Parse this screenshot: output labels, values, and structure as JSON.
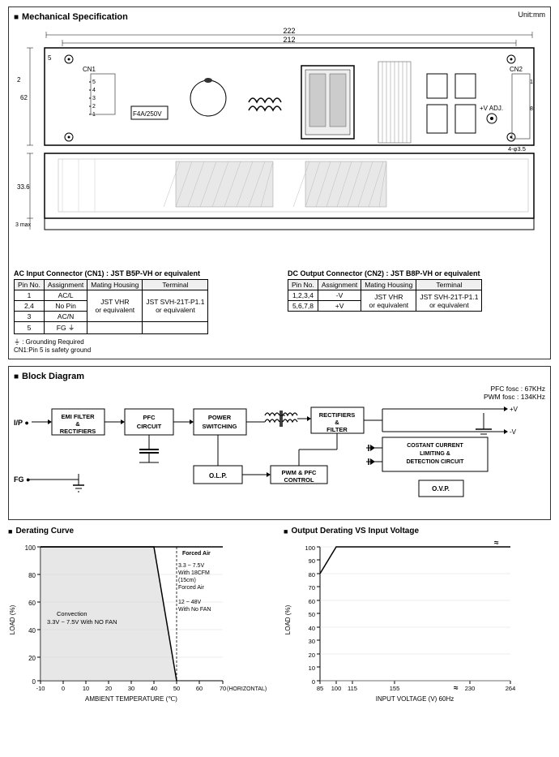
{
  "page": {
    "unit": "Unit:mm"
  },
  "mechanical": {
    "title": "Mechanical Specification",
    "unit": "Unit:mm",
    "dimensions": {
      "top": "222",
      "middle": "212",
      "left_height": "62",
      "left_small": "2",
      "bottom_height": "33.6",
      "bottom_small": "3 max",
      "left_width": "5",
      "hole": "4-φ3.5"
    },
    "labels": {
      "cn1": "CN1",
      "cn2": "CN2",
      "fuse": "F4A/250V",
      "vadj": "+V ADJ.",
      "pin5": "5",
      "pin4": "4",
      "pin3": "3",
      "pin2": "2",
      "pin1": "1"
    }
  },
  "connector_cn1": {
    "title": "AC Input Connector (CN1) : JST B5P-VH or equivalent",
    "headers": [
      "Pin No.",
      "Assignment",
      "Mating Housing",
      "Terminal"
    ],
    "rows": [
      [
        "1",
        "AC/L",
        "",
        ""
      ],
      [
        "2,4",
        "No Pin",
        "JST VHR",
        "JST SVH-21T-P1.1"
      ],
      [
        "3",
        "AC/N",
        "or equivalent",
        "or equivalent"
      ],
      [
        "5",
        "FG ⏚",
        "",
        ""
      ]
    ]
  },
  "connector_cn2": {
    "title": "DC Output Connector (CN2) : JST B8P-VH or equivalent",
    "headers": [
      "Pin No.",
      "Assignment",
      "Mating Housing",
      "Terminal"
    ],
    "rows": [
      [
        "1,2,3,4",
        "-V",
        "JST VHR",
        "JST SVH-21T-P1.1"
      ],
      [
        "5,6,7,8",
        "+V",
        "or equivalent",
        "or equivalent"
      ]
    ]
  },
  "grounding": {
    "line1": "⏚ : Grounding Required",
    "line2": "CN1:Pin 5 is safety ground"
  },
  "block_diagram": {
    "title": "Block Diagram",
    "fosc1": "PFC fosc : 67KHz",
    "fosc2": "PWM fosc : 134KHz",
    "blocks": [
      {
        "id": "emi",
        "label": "EMI FILTER\n& \nRECTIFIERS"
      },
      {
        "id": "pfc",
        "label": "PFC\nCIRCUIT"
      },
      {
        "id": "power",
        "label": "POWER\nSWITCHING"
      },
      {
        "id": "rect",
        "label": "RECTIFIERS\n&\nFILTER"
      },
      {
        "id": "olp",
        "label": "O.L.P."
      },
      {
        "id": "pwm",
        "label": "PWM & PFC\nCONTROL"
      },
      {
        "id": "cc",
        "label": "COSTANT CURRENT\nLIMITING &\nDETECTION CIRCUIT"
      },
      {
        "id": "ovp",
        "label": "O.V.P."
      }
    ],
    "labels": {
      "ip": "I/P",
      "fg": "FG",
      "vplus": "+V",
      "vminus": "-V"
    }
  },
  "derating_curve": {
    "title": "Derating Curve",
    "x_label": "AMBIENT TEMPERATURE (℃)",
    "y_label": "LOAD (%)",
    "x_axis": [
      "-10",
      "0",
      "10",
      "20",
      "30",
      "40",
      "50",
      "60",
      "70"
    ],
    "x_suffix": "(HORIZONTAL)",
    "y_axis": [
      "0",
      "20",
      "40",
      "60",
      "80",
      "100"
    ],
    "annotations": {
      "forced_air": "Forced Air",
      "range1": "3.3 ~ 7.5V\nWith 18CFM\n(15cm)\nForced Air",
      "range2": "12 ~ 48V\nWith No FAN",
      "convection": "Convection\n3.3V ~ 7.5V With NO FAN"
    }
  },
  "output_derating": {
    "title": "Output Derating VS Input Voltage",
    "x_label": "INPUT VOLTAGE (V) 60Hz",
    "y_label": "LOAD (%)",
    "x_axis": [
      "85",
      "100",
      "115",
      "155",
      "230",
      "264"
    ],
    "y_axis": [
      "0",
      "10",
      "20",
      "30",
      "40",
      "50",
      "60",
      "70",
      "80",
      "90",
      "100"
    ]
  }
}
